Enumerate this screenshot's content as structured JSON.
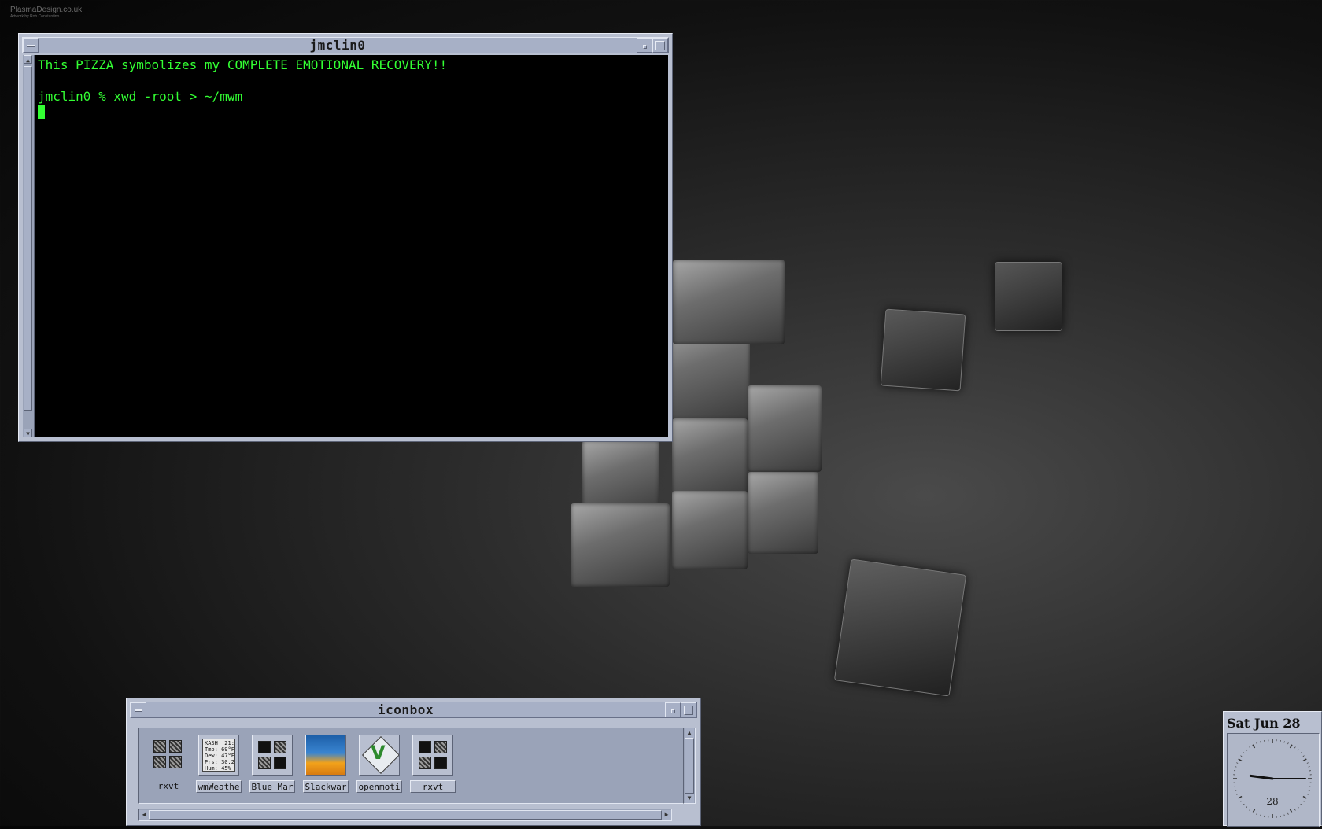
{
  "desktop": {
    "credit_line1": "PlasmaDesign.co.uk",
    "credit_line2": "Artwork by Rob Constantino"
  },
  "terminal": {
    "title": "jmclin0",
    "lines": [
      "This PIZZA symbolizes my COMPLETE EMOTIONAL RECOVERY!!",
      "",
      "jmclin0 % xwd -root > ~/mwm"
    ]
  },
  "iconbox": {
    "title": "iconbox",
    "icons": [
      {
        "label": "rxvt",
        "icon": "terminal-grid-icon"
      },
      {
        "label": "wmWeathe",
        "icon": "weather-icon",
        "weather": "KASH  21:5\nTmp: 69°F\nDew: 47°F\nPrs: 30.26\nHum: 45%"
      },
      {
        "label": "Blue Mar",
        "icon": "window-grid-icon"
      },
      {
        "label": "Slackwar",
        "icon": "slackware-icon"
      },
      {
        "label": "openmoti",
        "icon": "vim-icon"
      },
      {
        "label": "rxvt",
        "icon": "window-grid-icon"
      }
    ]
  },
  "clock": {
    "date": "Sat Jun 28",
    "day": "28",
    "time": {
      "hour": 9,
      "minute": 15
    }
  },
  "colors": {
    "terminal_fg": "#33ff33",
    "terminal_bg": "#000000",
    "motif_frame": "#b8bfd0"
  }
}
